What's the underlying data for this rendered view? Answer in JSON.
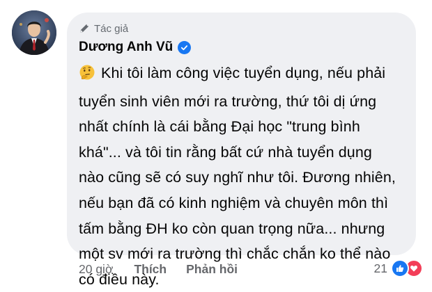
{
  "author": {
    "badge_label": "Tác giả",
    "name": "Dương Anh Vũ",
    "badge_icon": "pen-icon",
    "verified_icon": "verified-check-icon"
  },
  "comment": {
    "emoji_icon": "thinking-face-emoji",
    "lines": [
      "Khi tôi làm công việc tuyển dụng, nếu phải",
      "tuyển sinh viên mới ra trường, thứ tôi dị ứng",
      "nhất chính là cái bằng Đại học \"trung bình",
      "khá\"... và tôi tin rằng bất cứ nhà tuyển dụng",
      "nào cũng sẽ có suy nghĩ như tôi. Đương nhiên,",
      "nếu bạn đã có kinh nghiệm và chuyên môn thì",
      "tấm bằng ĐH ko còn quan trọng nữa... nhưng",
      "một sv mới ra trường thì chắc chắn ko thể nào",
      "có điều này."
    ]
  },
  "actions": {
    "time": "20 giờ",
    "like_label": "Thích",
    "reply_label": "Phản hồi"
  },
  "reactions": {
    "count": "21",
    "icons": [
      "like-reaction-icon",
      "love-reaction-icon"
    ]
  },
  "colors": {
    "bubble": "#eff0f3",
    "muted_text": "#65676b",
    "like_blue": "#1877f2",
    "love_red": "#f33e58"
  }
}
